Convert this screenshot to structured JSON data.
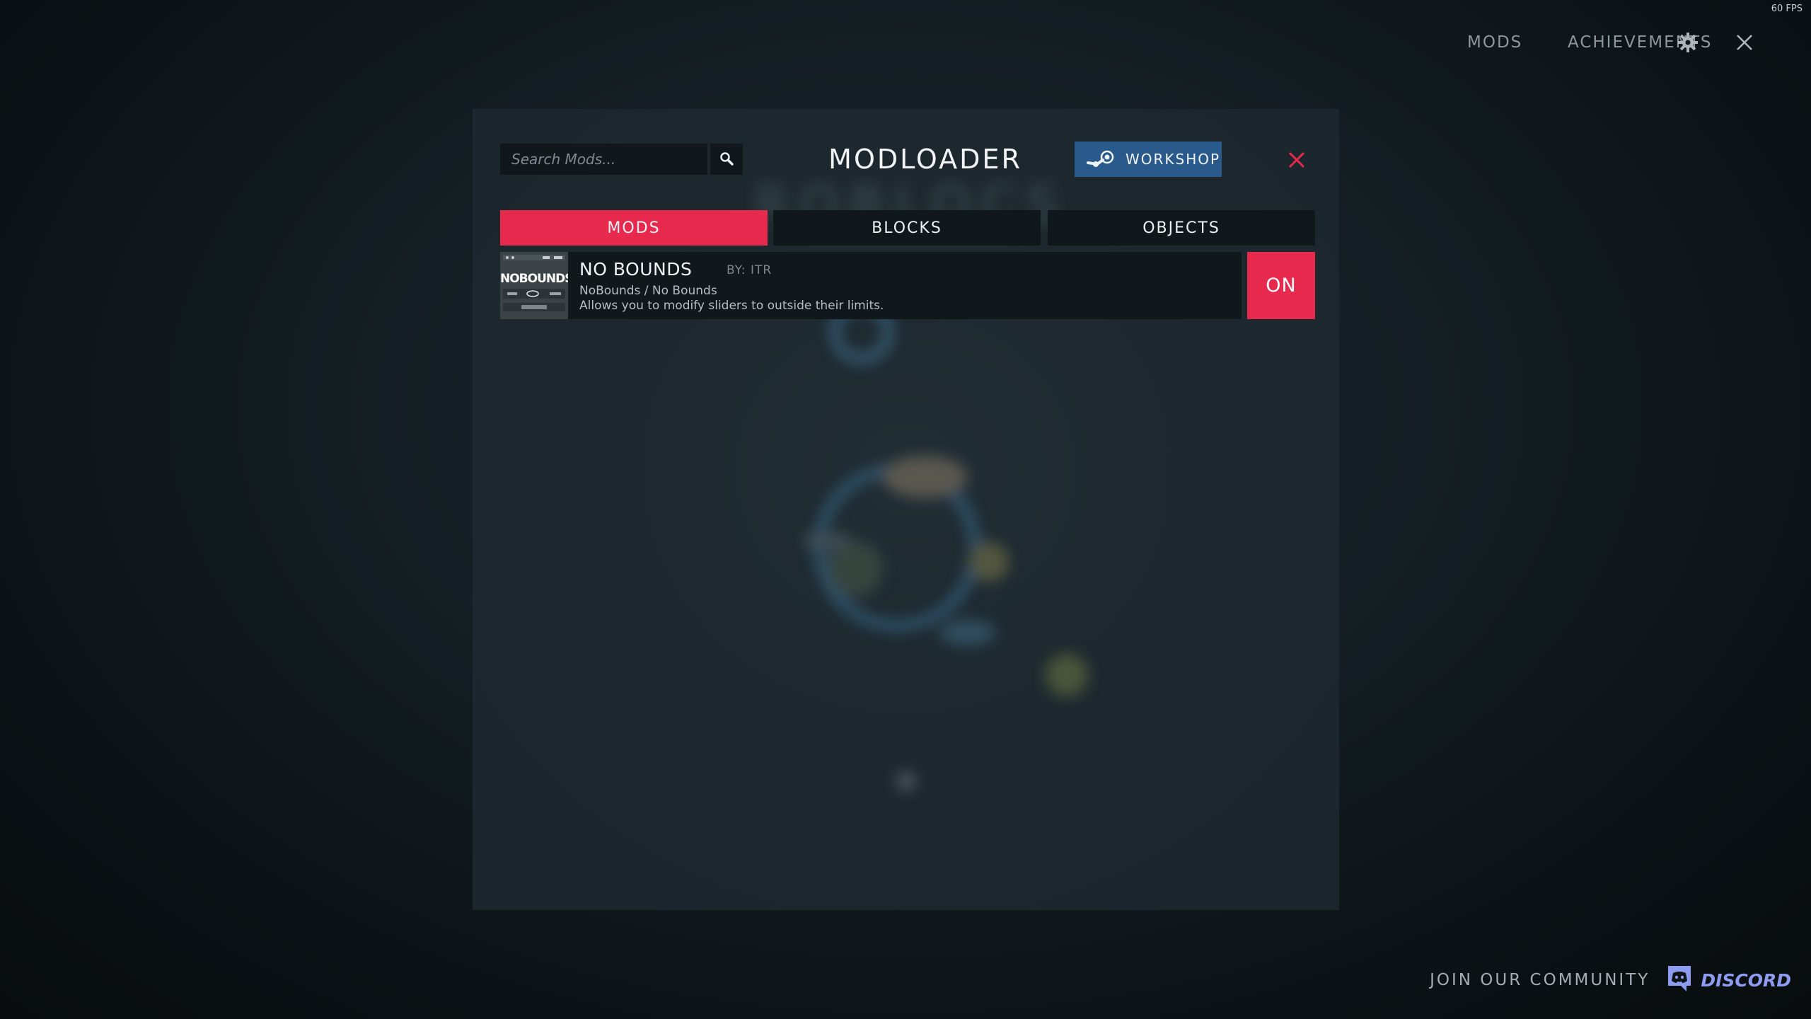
{
  "hud": {
    "fps": "60 FPS"
  },
  "topnav": {
    "mods_label": "MODS",
    "achievements_label": "ACHIEVEMENTS",
    "settings_icon": "gear-icon",
    "close_icon": "close-icon"
  },
  "modal": {
    "title": "MODLOADER",
    "search": {
      "placeholder": "Search Mods...",
      "value": ""
    },
    "search_icon": "search-icon",
    "workshop_label": "WORKSHOP",
    "workshop_icon": "steam-icon",
    "close_icon": "close-icon",
    "tabs": [
      {
        "label": "MODS",
        "active": true
      },
      {
        "label": "BLOCKS",
        "active": false
      },
      {
        "label": "OBJECTS",
        "active": false
      }
    ],
    "mods": [
      {
        "thumbnail_text": "NOBOUNDS",
        "name": "NO BOUNDS",
        "author": "BY: ITR",
        "path": "NoBounds / No Bounds",
        "description": "Allows you to modify sliders to outside their limits.",
        "toggle_label": "ON"
      }
    ]
  },
  "footer": {
    "community_label": "JOIN OUR COMMUNITY",
    "discord_label": "DISCORD"
  },
  "colors": {
    "accent": "#e8294e",
    "workshop": "#2a5a8c",
    "panel": "#1c272d",
    "dark": "#11181c",
    "discord": "#8d9bf0"
  }
}
